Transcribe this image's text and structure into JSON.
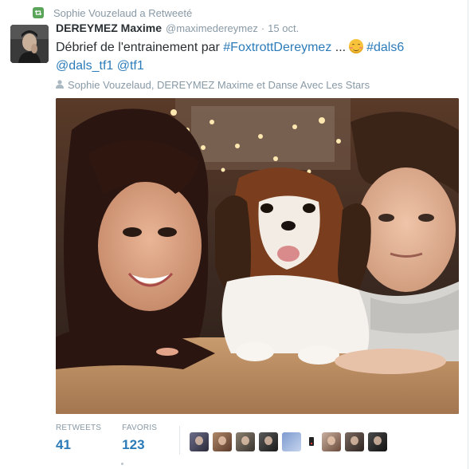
{
  "retweet_header": {
    "text": "Sophie Vouzelaud a Retweeté",
    "icon": "retweet-icon",
    "icon_color": "#5aa55a"
  },
  "tweet": {
    "author_name": "DEREYMEZ Maxime",
    "handle": "@maximedereymez",
    "separator": "·",
    "date": "15 oct.",
    "text_plain": "Débrief de l'entrainement par ",
    "hashtag1": "#FoxtrottDereymez",
    "ellipsis": " ...",
    "emoji": "smiling-face-emoji",
    "hashtag2": "#dals6",
    "mention1": "@dals_tf1",
    "mention2": "@tf1",
    "tagged": "Sophie Vouzelaud, DEREYMEZ Maxime et Danse Avec Les Stars",
    "link_color": "#2b7bb9"
  },
  "photo": {
    "description_icon": "selfie-photo"
  },
  "stats": {
    "retweets_label": "RETWEETS",
    "retweets_value": "41",
    "favorites_label": "FAVORIS",
    "favorites_value": "123"
  },
  "favoriters": {
    "count": 9
  }
}
